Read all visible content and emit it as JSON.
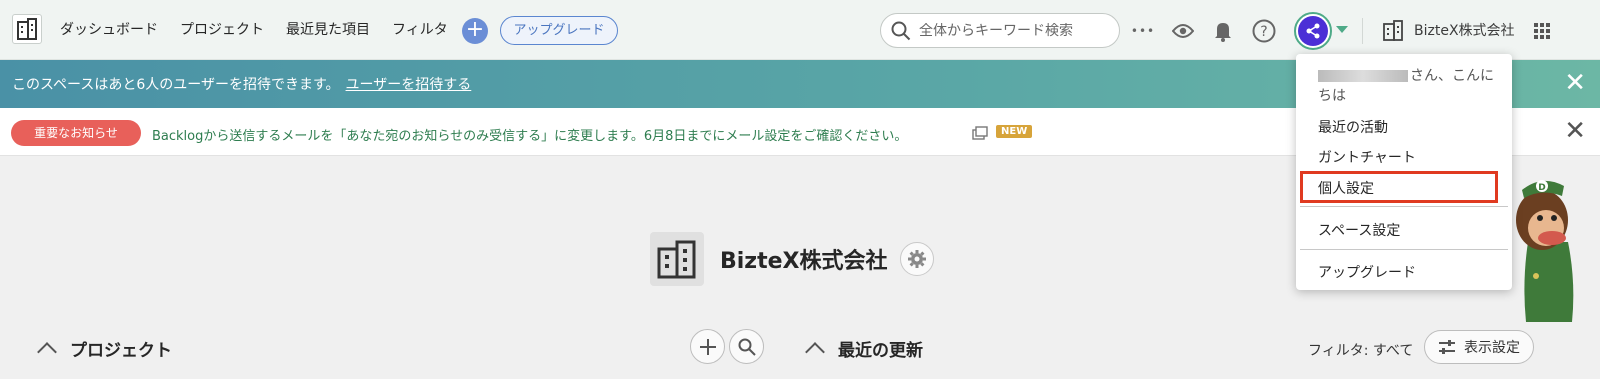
{
  "header": {
    "nav": [
      "ダッシュボード",
      "プロジェクト",
      "最近見た項目",
      "フィルタ"
    ],
    "add_label": "+",
    "upgrade_label": "アップグレード",
    "search_placeholder": "全体からキーワード検索",
    "more_label": "•••",
    "org_name": "BizteX株式会社",
    "accent_color": "#4eaa88"
  },
  "invite_banner": {
    "text": "このスペースはあと6人のユーザーを招待できます。",
    "link": "ユーザーを招待する",
    "close": "✕"
  },
  "notice": {
    "badge": "重要なお知らせ",
    "message": "Backlogから送信するメールを「あなた宛のお知らせのみ受信する」に変更します。6月8日までにメール設定をご確認ください。",
    "new_label": "NEW",
    "close": "✕"
  },
  "space": {
    "name": "BizteX株式会社"
  },
  "projects": {
    "title": "プロジェクト"
  },
  "recent": {
    "title": "最近の更新",
    "filter_label": "フィルタ: すべて",
    "display_settings": "表示設定"
  },
  "user_menu": {
    "greeting": "さん、こんにちは",
    "items": [
      "最近の活動",
      "ガントチャート",
      "個人設定",
      "スペース設定",
      "アップグレード"
    ],
    "highlighted": "個人設定"
  }
}
